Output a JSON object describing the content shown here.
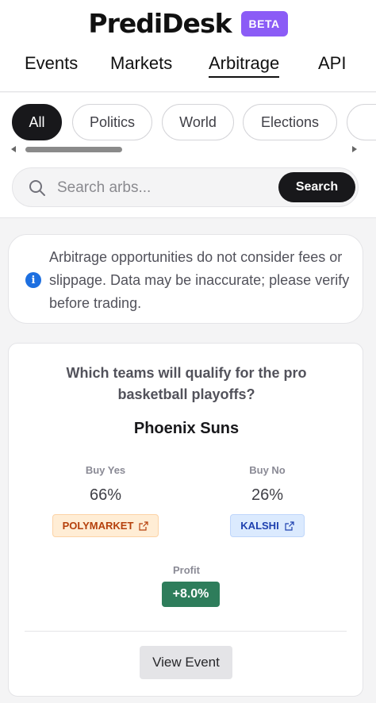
{
  "header": {
    "logo": "PrediDesk",
    "badge": "BETA",
    "nav": [
      {
        "label": "Events",
        "active": false
      },
      {
        "label": "Markets",
        "active": false
      },
      {
        "label": "Arbitrage",
        "active": true
      },
      {
        "label": "API",
        "active": false
      }
    ]
  },
  "filters": {
    "chips": [
      {
        "label": "All",
        "active": true
      },
      {
        "label": "Politics",
        "active": false
      },
      {
        "label": "World",
        "active": false
      },
      {
        "label": "Elections",
        "active": false
      }
    ]
  },
  "search": {
    "placeholder": "Search arbs...",
    "button_label": "Search"
  },
  "notice": {
    "icon": "info-icon",
    "text": "Arbitrage opportunities do not consider fees or slippage. Data may be inaccurate; please verify before trading."
  },
  "arb_card": {
    "question": "Which teams will qualify for the pro basketball playoffs?",
    "outcome": "Phoenix Suns",
    "buy_yes": {
      "label": "Buy Yes",
      "price": "66%",
      "venue": "POLYMARKET"
    },
    "buy_no": {
      "label": "Buy No",
      "price": "26%",
      "venue": "KALSHI"
    },
    "profit_label": "Profit",
    "profit_value": "+8.0%",
    "view_button": "View Event"
  },
  "colors": {
    "beta": "#8b5cf6",
    "profit": "#2e7d5b",
    "polymarket_text": "#b5400c",
    "kalshi_text": "#1e40af",
    "info_icon": "#1d6fe0"
  }
}
